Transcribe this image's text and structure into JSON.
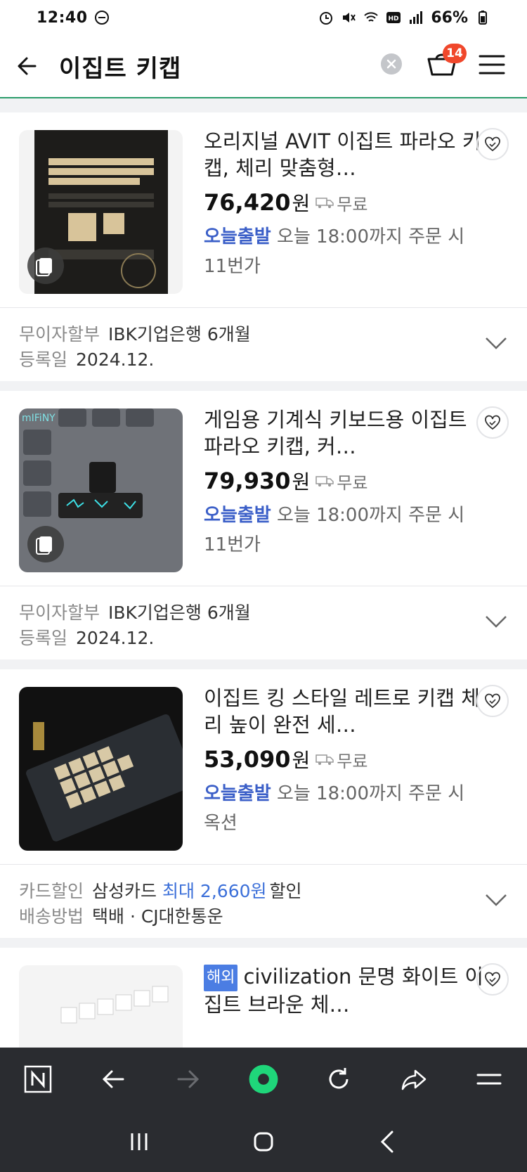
{
  "status": {
    "time": "12:40",
    "battery": "66%"
  },
  "header": {
    "title": "이집트 키캡",
    "cart_count": "14"
  },
  "colors": {
    "accent_green": "#2b9c6b",
    "badge_red": "#f0472b",
    "today_blue": "#3b5fc8"
  },
  "products": [
    {
      "name": "오리지널 AVIT 이집트 파라오 키캡, 체리 맞춤형…",
      "price": "76,420",
      "won": "원",
      "shipping": "무료",
      "today_label": "오늘출발",
      "delivery_text": "오늘 18:00까지 주문 시",
      "seller": "11번가",
      "extra": [
        {
          "key": "무이자할부",
          "value": "IBK기업은행 6개월"
        },
        {
          "key": "등록일",
          "value": "2024.12."
        }
      ]
    },
    {
      "name": "게임용 기계식 키보드용 이집트 파라오 키캡, 커…",
      "price": "79,930",
      "won": "원",
      "shipping": "무료",
      "today_label": "오늘출발",
      "delivery_text": "오늘 18:00까지 주문 시",
      "seller": "11번가",
      "extra": [
        {
          "key": "무이자할부",
          "value": "IBK기업은행 6개월"
        },
        {
          "key": "등록일",
          "value": "2024.12."
        }
      ]
    },
    {
      "name": "이집트 킹 스타일 레트로 키캡 체리 높이 완전 세…",
      "price": "53,090",
      "won": "원",
      "shipping": "무료",
      "today_label": "오늘출발",
      "delivery_text": "오늘 18:00까지 주문 시",
      "seller": "옥션",
      "extra": [
        {
          "key": "카드할인",
          "value": "삼성카드",
          "blue": "최대 2,660원",
          "tail": "할인"
        },
        {
          "key": "배송방법",
          "value": "택배 · CJ대한통운"
        }
      ]
    },
    {
      "tag": "해외",
      "name": "civilization 문명 화이트 이집트 브라운 체…"
    }
  ]
}
